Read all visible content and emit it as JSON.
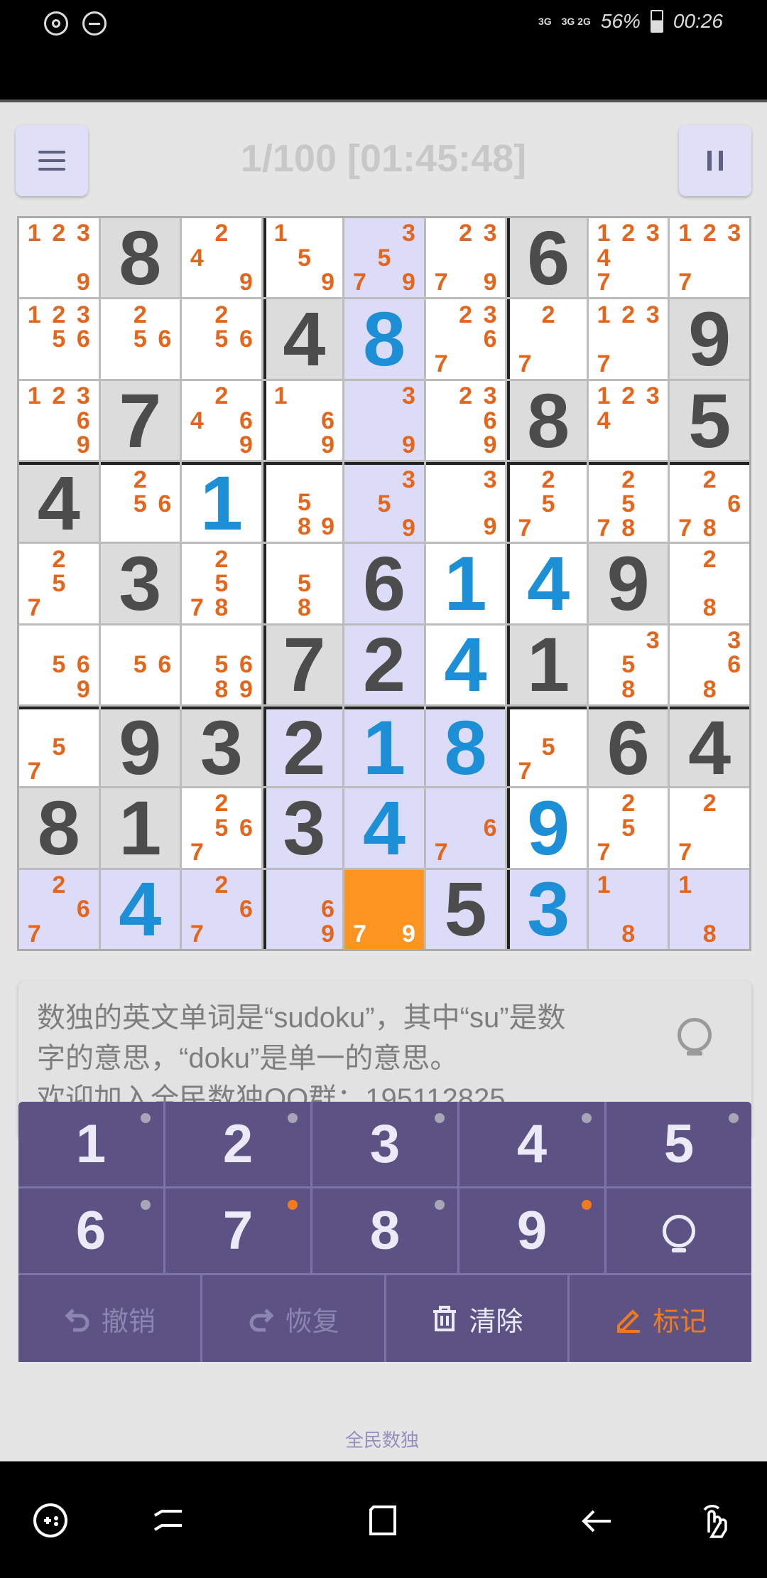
{
  "status_bar": {
    "net_top": "3G",
    "net_bottom": "3G 2G",
    "battery": "56%",
    "time": "00:26"
  },
  "header": {
    "title": "1/100 [01:45:48]"
  },
  "board": {
    "cells": [
      [
        {
          "n": "1239"
        },
        {
          "v": "8",
          "g": 1
        },
        {
          "n": "249"
        },
        {
          "n": "159"
        },
        {
          "n": "3579",
          "h": 1
        },
        {
          "n": "2379"
        },
        {
          "v": "6",
          "g": 1
        },
        {
          "n": "12347"
        },
        {
          "n": "1237"
        }
      ],
      [
        {
          "n": "12356"
        },
        {
          "n": "256"
        },
        {
          "n": "256"
        },
        {
          "v": "4",
          "g": 1
        },
        {
          "v": "8",
          "u": 1,
          "h": 1
        },
        {
          "n": "2367"
        },
        {
          "n": "27"
        },
        {
          "n": "1237"
        },
        {
          "v": "9",
          "g": 1
        }
      ],
      [
        {
          "n": "12369"
        },
        {
          "v": "7",
          "g": 1
        },
        {
          "n": "2469"
        },
        {
          "n": "169"
        },
        {
          "n": "39",
          "h": 1
        },
        {
          "n": "2369"
        },
        {
          "v": "8",
          "g": 1
        },
        {
          "n": "1234"
        },
        {
          "v": "5",
          "g": 1
        }
      ],
      [
        {
          "v": "4",
          "g": 1
        },
        {
          "n": "256"
        },
        {
          "v": "1",
          "u": 1
        },
        {
          "n": "589"
        },
        {
          "n": "359",
          "h": 1
        },
        {
          "n": "39"
        },
        {
          "n": "257"
        },
        {
          "n": "2578"
        },
        {
          "n": "2678"
        }
      ],
      [
        {
          "n": "257"
        },
        {
          "v": "3",
          "g": 1
        },
        {
          "n": "2578"
        },
        {
          "n": "58"
        },
        {
          "v": "6",
          "g": 1,
          "h": 1
        },
        {
          "v": "1",
          "u": 1
        },
        {
          "v": "4",
          "u": 1
        },
        {
          "v": "9",
          "g": 1
        },
        {
          "n": "28"
        }
      ],
      [
        {
          "n": "569"
        },
        {
          "n": "56"
        },
        {
          "n": "5689"
        },
        {
          "v": "7",
          "g": 1
        },
        {
          "v": "2",
          "g": 1,
          "h": 1
        },
        {
          "v": "4",
          "u": 1
        },
        {
          "v": "1",
          "g": 1
        },
        {
          "n": "358"
        },
        {
          "n": "368"
        }
      ],
      [
        {
          "n": "57"
        },
        {
          "v": "9",
          "g": 1
        },
        {
          "v": "3",
          "g": 1
        },
        {
          "v": "2",
          "g": 1,
          "h": 1
        },
        {
          "v": "1",
          "u": 1,
          "h": 1
        },
        {
          "v": "8",
          "u": 1,
          "h": 1
        },
        {
          "n": "57"
        },
        {
          "v": "6",
          "g": 1
        },
        {
          "v": "4",
          "g": 1
        }
      ],
      [
        {
          "v": "8",
          "g": 1
        },
        {
          "v": "1",
          "g": 1
        },
        {
          "n": "2567"
        },
        {
          "v": "3",
          "g": 1,
          "h": 1
        },
        {
          "v": "4",
          "u": 1,
          "h": 1
        },
        {
          "n": "67",
          "h": 1
        },
        {
          "v": "9",
          "u": 1
        },
        {
          "n": "257"
        },
        {
          "n": "27"
        }
      ],
      [
        {
          "n": "267",
          "h": 1
        },
        {
          "v": "4",
          "u": 1,
          "h": 1
        },
        {
          "n": "267",
          "h": 1
        },
        {
          "n": "69",
          "h": 1
        },
        {
          "n": "79",
          "s": 1
        },
        {
          "v": "5",
          "g": 1,
          "h": 1
        },
        {
          "v": "3",
          "u": 1,
          "h": 1
        },
        {
          "n": "18",
          "h": 1
        },
        {
          "n": "18",
          "h": 1
        }
      ]
    ]
  },
  "tip": {
    "text": "数独的英文单词是“sudoku”，其中“su”是数\n字的意思，“doku”是单一的意思。\n欢迎加入全民数独QQ群：195112825",
    "icon": "lightbulb-icon"
  },
  "keypad": {
    "keys": [
      "1",
      "2",
      "3",
      "4",
      "5",
      "6",
      "7",
      "8",
      "9"
    ],
    "dot_colors": {
      "normal": "#a8a5b6",
      "hot": "#f07a20"
    },
    "hot_keys": [
      "7",
      "9"
    ],
    "hint_icon": "lightbulb-icon",
    "undo": "撤销",
    "redo": "恢复",
    "clear": "清除",
    "mark": "标记"
  },
  "watermark": "全民数独",
  "colors": {
    "given": "#4c4c4c",
    "user": "#1d8fd6",
    "note": "#e4661c",
    "selected": "#fb9421",
    "highlight": "#dcdcf8",
    "keypad": "#5c5384"
  }
}
